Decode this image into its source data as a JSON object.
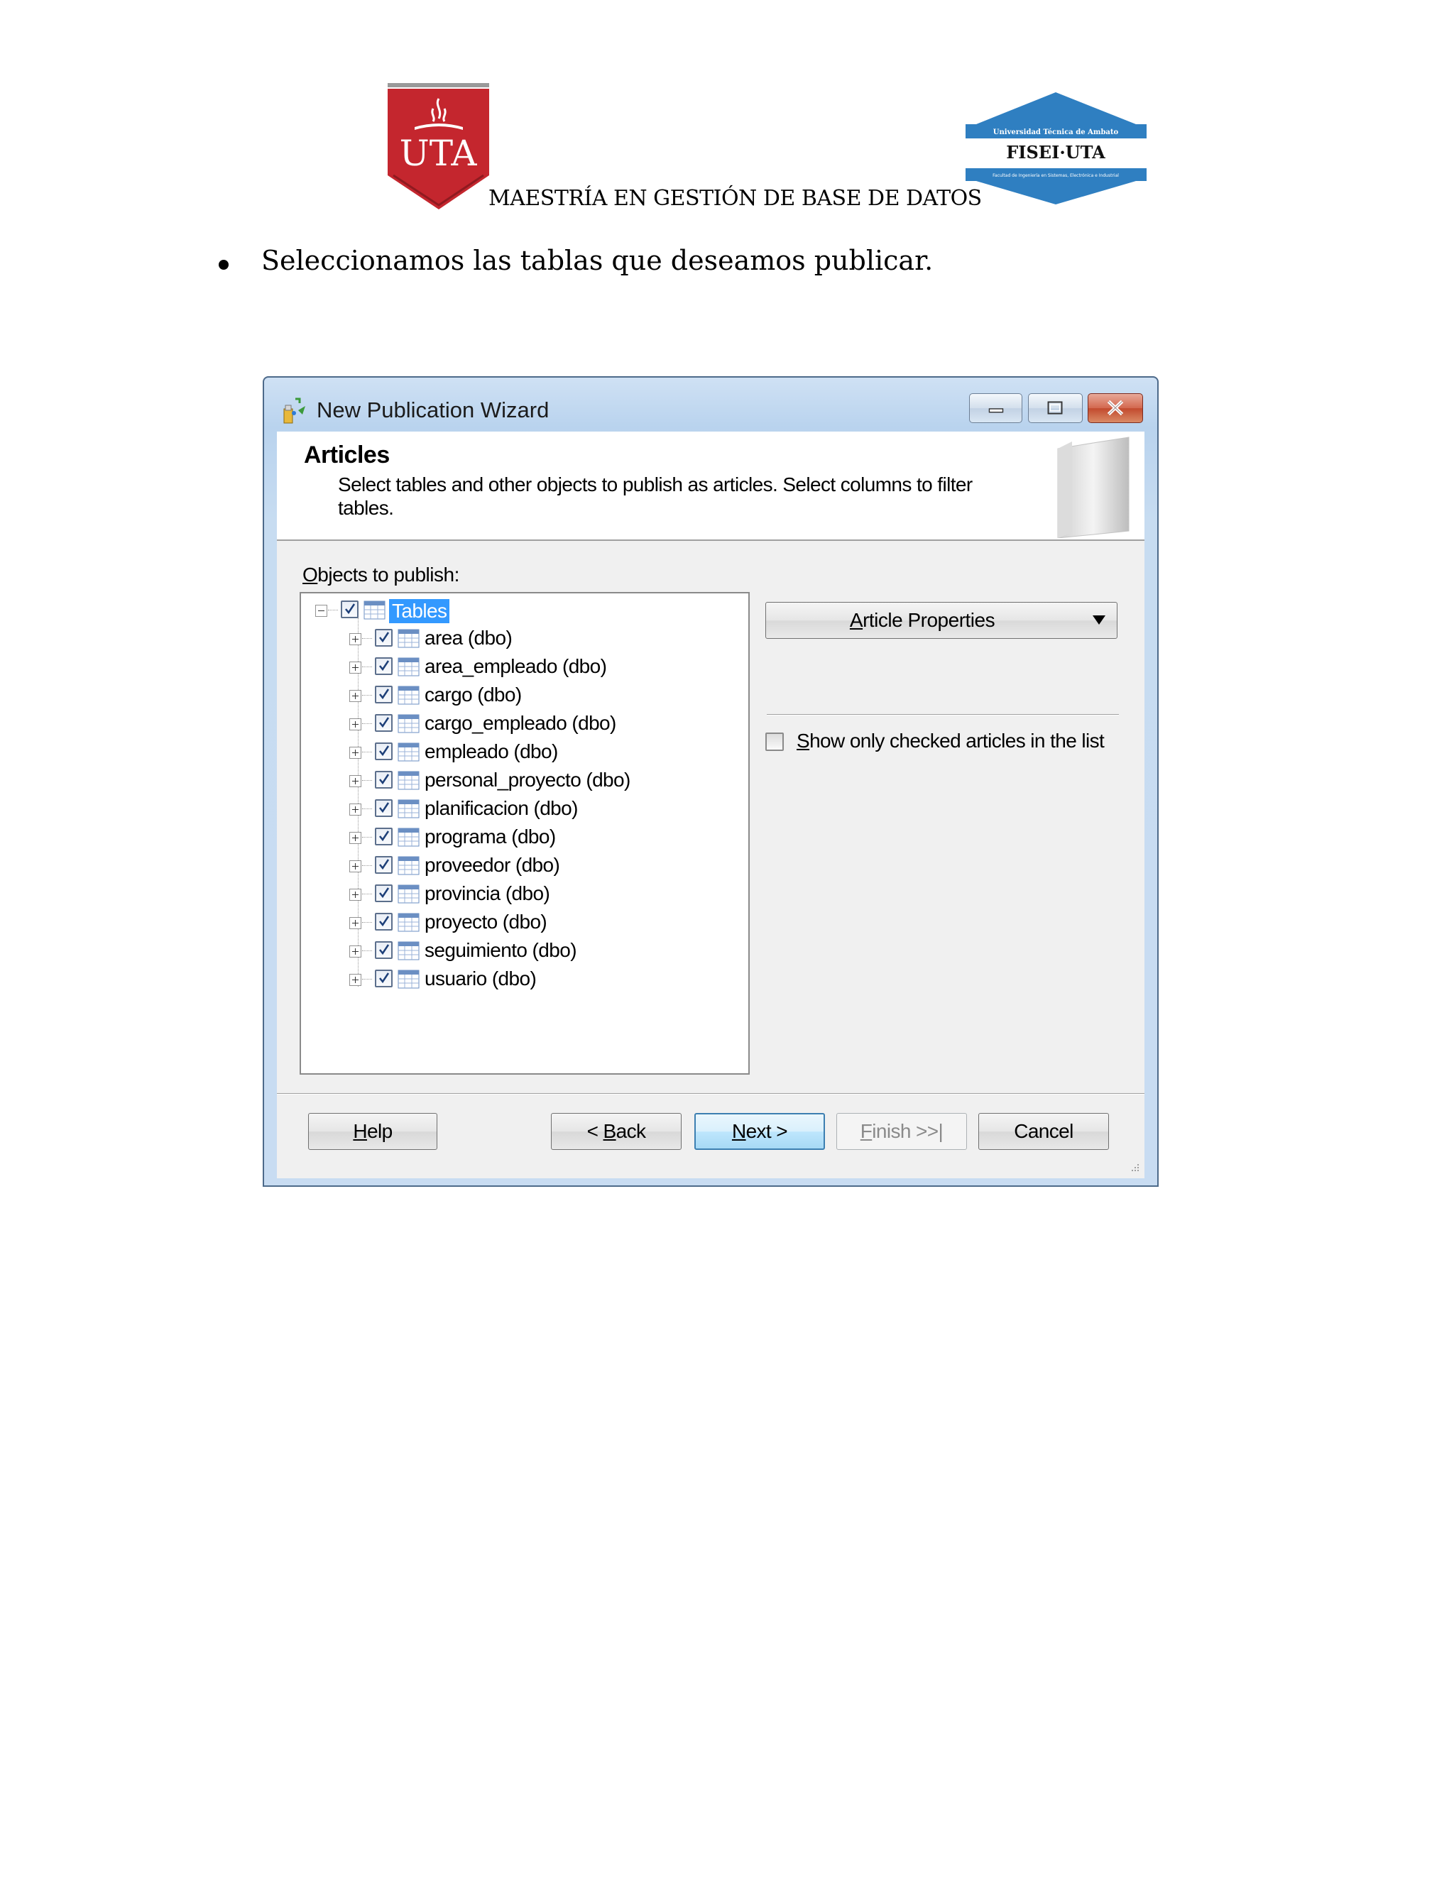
{
  "document": {
    "uta_logo_text": "UTA",
    "fisei_logo_text": "FISEI·UTA",
    "fisei_logo_top_text": "Universidad Técnica de Ambato",
    "fisei_logo_bottom_text": "Facultad de Ingeniería en Sistemas, Electrónica e Industrial",
    "header": "MAESTRÍA EN GESTIÓN DE BASE DE DATOS",
    "bullet_text": "Seleccionamos las tablas que deseamos publicar."
  },
  "window": {
    "title": "New Publication Wizard",
    "banner_title": "Articles",
    "banner_desc": "Select tables and other objects to publish as articles. Select columns to filter tables.",
    "objects_label_accel": "O",
    "objects_label_rest": "bjects to publish:",
    "tree": {
      "root": "Tables",
      "items": [
        "area (dbo)",
        "area_empleado (dbo)",
        "cargo (dbo)",
        "cargo_empleado (dbo)",
        "empleado (dbo)",
        "personal_proyecto (dbo)",
        "planificacion (dbo)",
        "programa (dbo)",
        "proveedor (dbo)",
        "provincia (dbo)",
        "proyecto (dbo)",
        "seguimiento (dbo)",
        "usuario (dbo)"
      ]
    },
    "article_properties_accel": "A",
    "article_properties_rest": "rticle Properties",
    "show_only_accel": "S",
    "show_only_rest": "how only checked articles in the list",
    "buttons": {
      "help_accel": "H",
      "help_rest": "elp",
      "back_pre": "< ",
      "back_accel": "B",
      "back_rest": "ack",
      "next_accel": "N",
      "next_rest": "ext >",
      "finish_accel": "F",
      "finish_rest": "inish >>|",
      "cancel": "Cancel"
    }
  }
}
